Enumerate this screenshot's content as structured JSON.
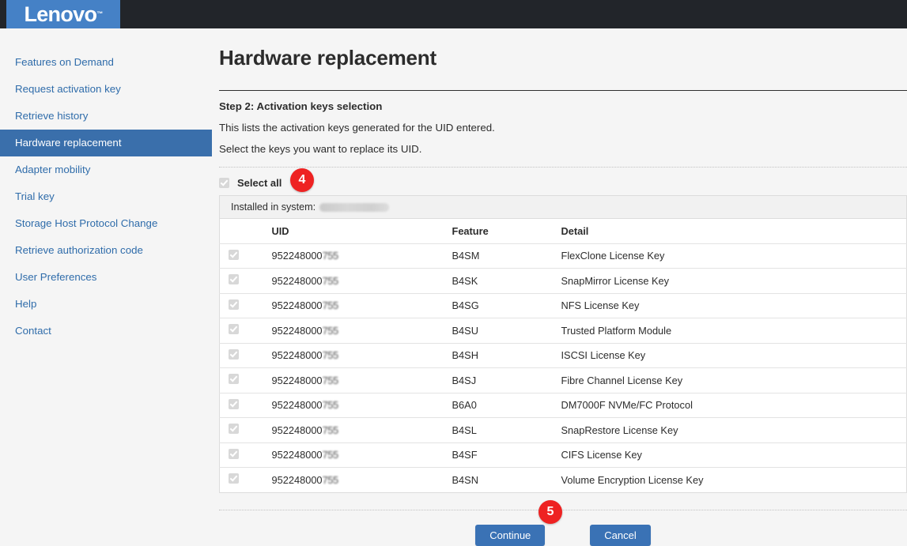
{
  "header": {
    "logo_text": "Lenovo",
    "logo_tm": "™",
    "logo_bg": "#4581c6",
    "bar_bg": "#22252a"
  },
  "sidebar": {
    "items": [
      {
        "label": "Features on Demand",
        "active": false
      },
      {
        "label": "Request activation key",
        "active": false
      },
      {
        "label": "Retrieve history",
        "active": false
      },
      {
        "label": "Hardware replacement",
        "active": true
      },
      {
        "label": "Adapter mobility",
        "active": false
      },
      {
        "label": "Trial key",
        "active": false
      },
      {
        "label": "Storage Host Protocol Change",
        "active": false
      },
      {
        "label": "Retrieve authorization code",
        "active": false
      },
      {
        "label": "User Preferences",
        "active": false
      },
      {
        "label": "Help",
        "active": false
      },
      {
        "label": "Contact",
        "active": false
      }
    ],
    "active_bg": "#3a6fab",
    "link_color": "#2f6caa"
  },
  "main": {
    "page_title": "Hardware replacement",
    "step_title": "Step 2: Activation keys selection",
    "step_line_1": "This lists the activation keys generated for the UID entered.",
    "step_line_2": "Select the keys you want to replace its UID.",
    "select_all_label": "Select all",
    "installed_label": "Installed in system:",
    "installed_value": ""
  },
  "badges": {
    "select_all_step": "4",
    "continue_step": "5",
    "color": "#ee2222"
  },
  "table": {
    "columns": [
      "",
      "UID",
      "Feature",
      "Detail"
    ],
    "rows": [
      {
        "checked": true,
        "uid_visible": "952248000",
        "uid_blurred": "755",
        "feature": "B4SM",
        "detail": "FlexClone License Key"
      },
      {
        "checked": true,
        "uid_visible": "952248000",
        "uid_blurred": "755",
        "feature": "B4SK",
        "detail": "SnapMirror License Key"
      },
      {
        "checked": true,
        "uid_visible": "952248000",
        "uid_blurred": "755",
        "feature": "B4SG",
        "detail": "NFS License Key"
      },
      {
        "checked": true,
        "uid_visible": "952248000",
        "uid_blurred": "755",
        "feature": "B4SU",
        "detail": "Trusted Platform Module"
      },
      {
        "checked": true,
        "uid_visible": "952248000",
        "uid_blurred": "755",
        "feature": "B4SH",
        "detail": "ISCSI License Key"
      },
      {
        "checked": true,
        "uid_visible": "952248000",
        "uid_blurred": "755",
        "feature": "B4SJ",
        "detail": "Fibre Channel License Key"
      },
      {
        "checked": true,
        "uid_visible": "952248000",
        "uid_blurred": "755",
        "feature": "B6A0",
        "detail": "DM7000F NVMe/FC Protocol"
      },
      {
        "checked": true,
        "uid_visible": "952248000",
        "uid_blurred": "755",
        "feature": "B4SL",
        "detail": "SnapRestore License Key"
      },
      {
        "checked": true,
        "uid_visible": "952248000",
        "uid_blurred": "755",
        "feature": "B4SF",
        "detail": "CIFS License Key"
      },
      {
        "checked": true,
        "uid_visible": "952248000",
        "uid_blurred": "755",
        "feature": "B4SN",
        "detail": "Volume Encryption License Key"
      }
    ]
  },
  "footer": {
    "continue_label": "Continue",
    "cancel_label": "Cancel",
    "button_color": "#3a72b5"
  }
}
